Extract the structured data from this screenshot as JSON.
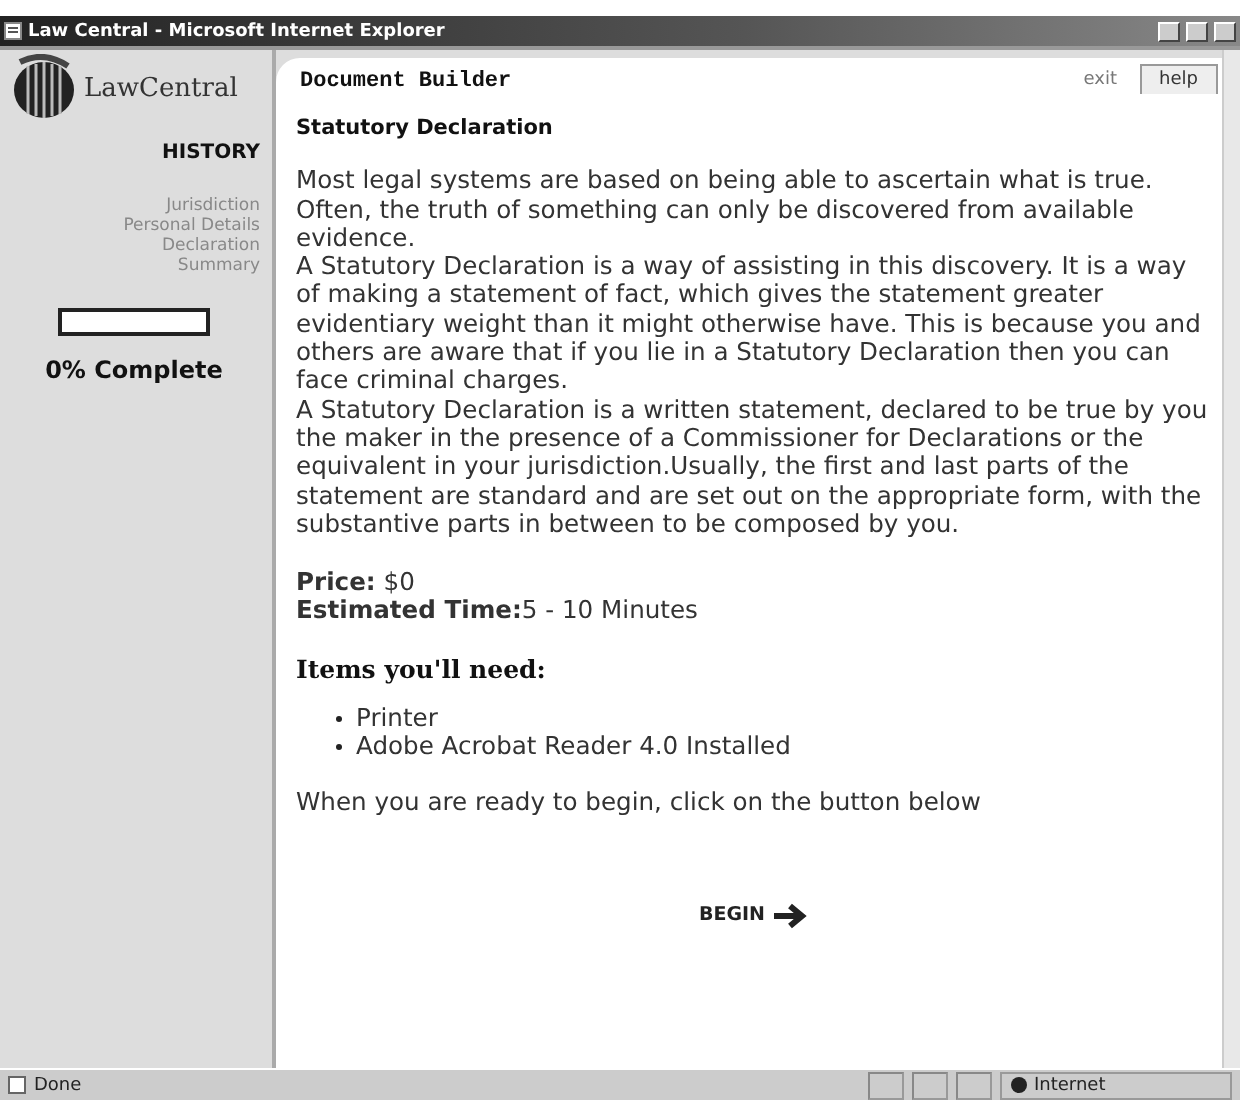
{
  "window": {
    "title": "Law Central - Microsoft Internet Explorer"
  },
  "sidebar": {
    "logo_text": "LawCentral",
    "history_heading": "HISTORY",
    "history_items": [
      "Jurisdiction",
      "Personal Details",
      "Declaration",
      "Summary"
    ],
    "progress": {
      "level": 0,
      "label": "0% Complete"
    }
  },
  "panel": {
    "title": "Document Builder",
    "tabs": [
      {
        "label": "exit",
        "selected": false
      },
      {
        "label": "help",
        "selected": true
      }
    ],
    "heading": "Statutory Declaration",
    "paragraphs": [
      "Most legal systems are based on being able to ascertain what is true. Often, the truth of something can only be discovered from available evidence.",
      "A Statutory Declaration is a way of assisting in this discovery. It is a way of making a statement of fact, which gives the statement greater evidentiary weight than it might otherwise have. This is because you and others are aware that if you lie in a Statutory Declaration then you can face criminal charges.",
      "A Statutory Declaration is a written statement, declared to be true by you the maker in the presence of a Commissioner for Declarations or the equivalent in your jurisdiction.Usually, the first and last parts of the statement are standard and are set out on the appropriate form, with the substantive parts in between to be composed by you."
    ],
    "price": "**Price:** $0",
    "time": "**Estimated Time:**5 - 10 Minutes",
    "items_heading": "Items you'll need:",
    "items": [
      "Printer",
      "Adobe Acrobat Reader 4.0 Installed"
    ],
    "instruction": "When you are ready to begin, click on the button below",
    "begin_button": "BEGIN"
  },
  "status_bar": {
    "text": "Done",
    "zone": "Internet"
  }
}
